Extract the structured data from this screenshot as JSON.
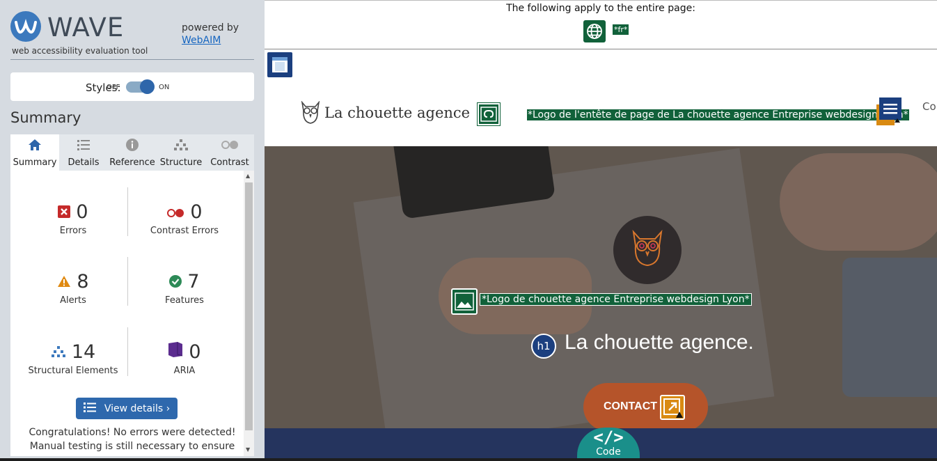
{
  "sidebar": {
    "logo_word": "WAVE",
    "logo_sub": "web accessibility evaluation tool",
    "powered_by": "powered by",
    "webaim_link": "WebAIM",
    "styles_label": "Styles:",
    "toggle_off": "OFF",
    "toggle_on": "ON",
    "toggle_state": "on",
    "summary_heading": "Summary",
    "tabs": [
      {
        "label": "Summary",
        "icon": "home-icon",
        "active": true
      },
      {
        "label": "Details",
        "icon": "list-icon",
        "active": false
      },
      {
        "label": "Reference",
        "icon": "info-icon",
        "active": false
      },
      {
        "label": "Structure",
        "icon": "hierarchy-icon",
        "active": false
      },
      {
        "label": "Contrast",
        "icon": "contrast-icon",
        "active": false
      }
    ],
    "stats": {
      "errors": {
        "count": "0",
        "label": "Errors",
        "icon": "error-icon",
        "color": "#c52a2a"
      },
      "contrast_errors": {
        "count": "0",
        "label": "Contrast Errors",
        "icon": "contrast-error-icon",
        "color": "#c52a2a"
      },
      "alerts": {
        "count": "8",
        "label": "Alerts",
        "icon": "alert-icon",
        "color": "#e08a12"
      },
      "features": {
        "count": "7",
        "label": "Features",
        "icon": "feature-icon",
        "color": "#2d8a57"
      },
      "structural": {
        "count": "14",
        "label": "Structural Elements",
        "icon": "structure-icon",
        "color": "#3c79bd"
      },
      "aria": {
        "count": "0",
        "label": "ARIA",
        "icon": "aria-icon",
        "color": "#5b2c8f"
      }
    },
    "view_details_label": "View details ›",
    "congrats_text": "Congratulations! No errors were detected! Manual testing is still necessary to ensure"
  },
  "preview": {
    "page_bar_text": "The following apply to the entire page:",
    "lang_badge": "*fr*",
    "brand_name": "La chouette agence",
    "header_alt": "*Logo de l'entête de page de La chouette agence Entreprise webdesign Lyon*",
    "nav_partial": "Co",
    "hero_alt": "*Logo de chouette agence Entreprise webdesign Lyon*",
    "h1_badge": "h1",
    "hero_title": "La chouette agence.",
    "contact_label": "CONTACT",
    "code_label": "Code",
    "colors": {
      "feature_green": "#11613a",
      "structure_blue": "#1b3f7f",
      "contact_orange": "#b5542a",
      "code_teal": "#1a8f8a",
      "footer_navy": "#25345e"
    }
  }
}
